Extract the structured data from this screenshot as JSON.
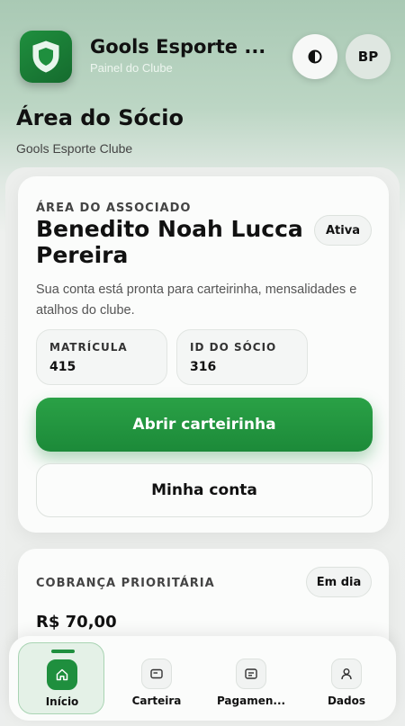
{
  "header": {
    "app_title": "Gools Esporte ...",
    "app_subtitle": "Painel do Clube",
    "avatar_initials": "BP"
  },
  "page": {
    "title": "Área do Sócio",
    "subtitle": "Gools Esporte Clube"
  },
  "member_card": {
    "eyebrow": "ÁREA DO ASSOCIADO",
    "name": "Benedito Noah Lucca Pereira",
    "status": "Ativa",
    "description": "Sua conta está pronta para carteirinha, mensalidades e atalhos do clube.",
    "registration_label": "MATRÍCULA",
    "registration_value": "415",
    "member_id_label": "ID DO SÓCIO",
    "member_id_value": "316",
    "primary_button": "Abrir carteirinha",
    "secondary_button": "Minha conta"
  },
  "billing": {
    "title": "COBRANÇA PRIORITÁRIA",
    "status": "Em dia",
    "amount": "R$ 70,00"
  },
  "nav": {
    "items": [
      {
        "label": "Início",
        "icon": "home-icon",
        "active": true
      },
      {
        "label": "Carteira",
        "icon": "card-icon",
        "active": false
      },
      {
        "label": "Pagamen...",
        "icon": "receipt-icon",
        "active": false
      },
      {
        "label": "Dados",
        "icon": "user-icon",
        "active": false
      }
    ]
  },
  "colors": {
    "accent": "#1f8f3e",
    "primary_button": "#23963f"
  }
}
